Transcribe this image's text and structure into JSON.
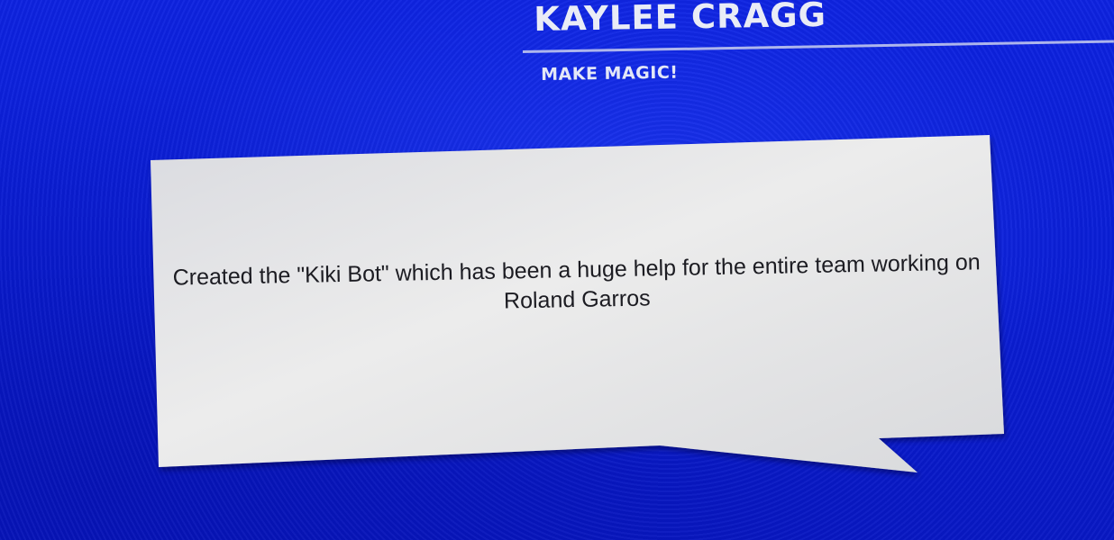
{
  "header": {
    "name": "KAYLEE CRAGG",
    "tagline": "MAKE MAGIC!"
  },
  "speech_bubble": {
    "text": "Created the \"Kiki Bot\" which has been a huge help for the entire team working on Roland Garros"
  },
  "colors": {
    "background": "#0b1fd8",
    "bubble_fill": "#e6e6e8",
    "heading_text": "#e9ecf6",
    "body_text": "#1c1c22"
  }
}
